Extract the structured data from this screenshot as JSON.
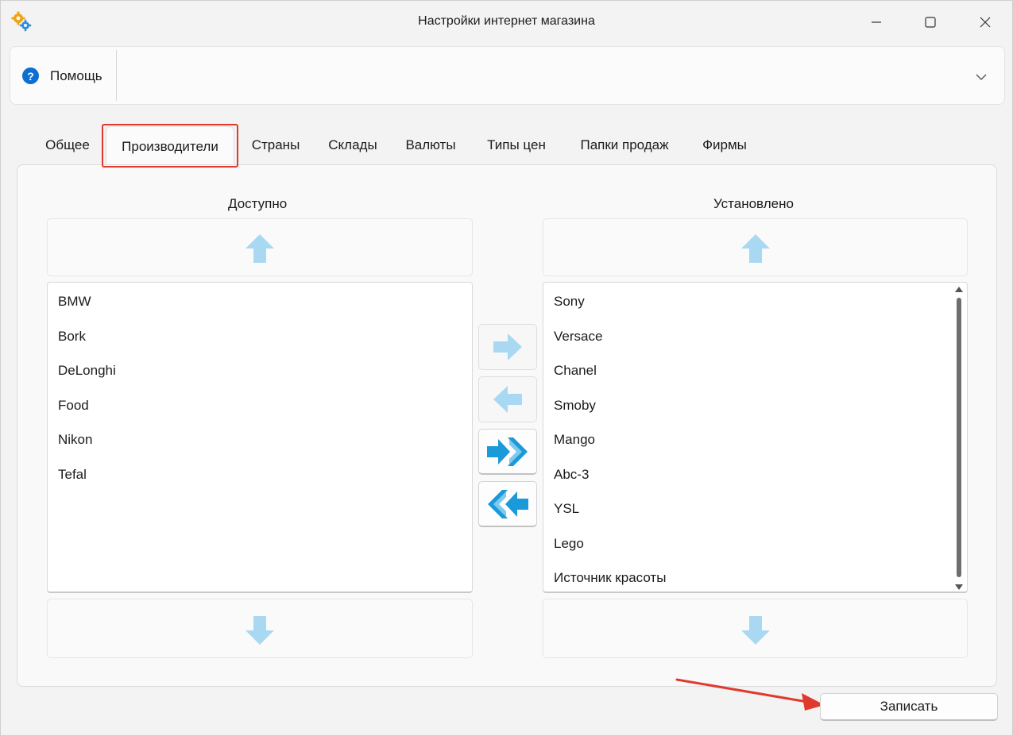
{
  "window": {
    "title": "Настройки интернет магазина",
    "icon": "gears-icon"
  },
  "help": {
    "label": "Помощь",
    "icon": "question-circle-icon",
    "accent": "#0d6fd1"
  },
  "tabs": [
    {
      "label": "Общее"
    },
    {
      "label": "Производители",
      "active": true
    },
    {
      "label": "Страны"
    },
    {
      "label": "Склады"
    },
    {
      "label": "Валюты"
    },
    {
      "label": "Типы цен"
    },
    {
      "label": "Папки продаж"
    },
    {
      "label": "Фирмы"
    }
  ],
  "available": {
    "title": "Доступно",
    "items": [
      "BMW",
      "Bork",
      "DeLonghi",
      "Food",
      "Nikon",
      "Tefal"
    ]
  },
  "installed": {
    "title": "Установлено",
    "items": [
      "Sony",
      "Versace",
      "Chanel",
      "Smoby",
      "Mango",
      "Abc-3",
      "YSL",
      "Lego",
      "Источник красоты"
    ]
  },
  "actions": {
    "save_label": "Записать"
  },
  "colors": {
    "arrow_light": "#a9d9f2",
    "arrow_dark": "#1a9ad9",
    "highlight": "#e03a2f"
  }
}
